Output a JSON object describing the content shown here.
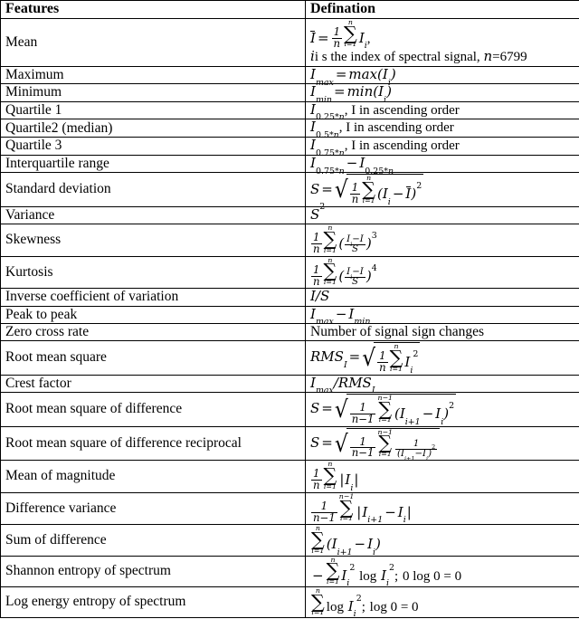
{
  "table": {
    "headers": {
      "feature": "Features",
      "definition": "Defination"
    },
    "rows": [
      {
        "feature": "Mean",
        "definition_text": "Ī = (1/n) Σ(i=1..n) I_i,  i s the index of spectral signal, n=6799",
        "note": "i s the index of spectral signal, ",
        "n_value": "=6799"
      },
      {
        "feature": "Maximum",
        "definition_text": "I_max = max(I_i)"
      },
      {
        "feature": "Minimum",
        "definition_text": "I_min = min(I_i)"
      },
      {
        "feature": "Quartile 1",
        "definition_text": "I_0.25*n, I in ascending order",
        "tail": ", I in ascending order"
      },
      {
        "feature": "Quartile2 (median)",
        "definition_text": "I_0.5*n, I in ascending order",
        "tail": ", I in ascending order"
      },
      {
        "feature": "Quartile 3",
        "definition_text": "I_0.75*n, I in ascending order",
        "tail": ", I in ascending order"
      },
      {
        "feature": "Interquartile range",
        "definition_text": "I_0.75*n − I_0.25*n"
      },
      {
        "feature": "Standard deviation",
        "definition_text": "S = sqrt( (1/n) Σ(i=1..n) (I_i − Ī)^2 )"
      },
      {
        "feature": "Variance",
        "definition_text": "S^2"
      },
      {
        "feature": "Skewness",
        "definition_text": "(1/n) Σ(i=1..n) ((I_i − I)/S)^3"
      },
      {
        "feature": "Kurtosis",
        "definition_text": "(1/n) Σ(i=1..n) ((I_i − I)/S)^4"
      },
      {
        "feature": "Inverse coefficient of variation",
        "definition_text": "I/S"
      },
      {
        "feature": "Peak to peak",
        "definition_text": "I_max − I_min"
      },
      {
        "feature": "Zero cross rate",
        "definition_text": "Number of signal sign changes"
      },
      {
        "feature": "Root mean square",
        "definition_text": "RMS_I = sqrt( (1/n) Σ(i=1..n) I_i^2 )"
      },
      {
        "feature": "Crest factor",
        "definition_text": "I_max / RMS_I"
      },
      {
        "feature": "Root mean square of difference",
        "definition_text": "S = sqrt( (1/(n−1)) Σ(i=1..n−1) (I_{i+1} − I_i)^2 )"
      },
      {
        "feature": "Root mean square of difference reciprocal",
        "definition_text": "S = sqrt( (1/(n−1)) Σ(i=1..n−1) 1/(I_{i+1} − I_i)^2 )"
      },
      {
        "feature": "Mean of magnitude",
        "definition_text": "(1/n) Σ(i=1..n) |I_i|"
      },
      {
        "feature": "Difference variance",
        "definition_text": "(1/(n−1)) Σ(i=1..n−1) |I_{i+1} − I_i|"
      },
      {
        "feature": "Sum of difference",
        "definition_text": "Σ(i=1..n) (I_{i+1} − I_i)"
      },
      {
        "feature": "Shannon entropy of spectrum",
        "definition_text": "− Σ(i=1..n) I_i^2 log I_i^2 ; 0 log 0 = 0"
      },
      {
        "feature": "Log energy entropy of spectrum",
        "definition_text": "Σ(i=1..n) log I_i^2 ; log 0 = 0"
      }
    ],
    "zero_cross_rate_definition": "Number of signal sign changes"
  }
}
